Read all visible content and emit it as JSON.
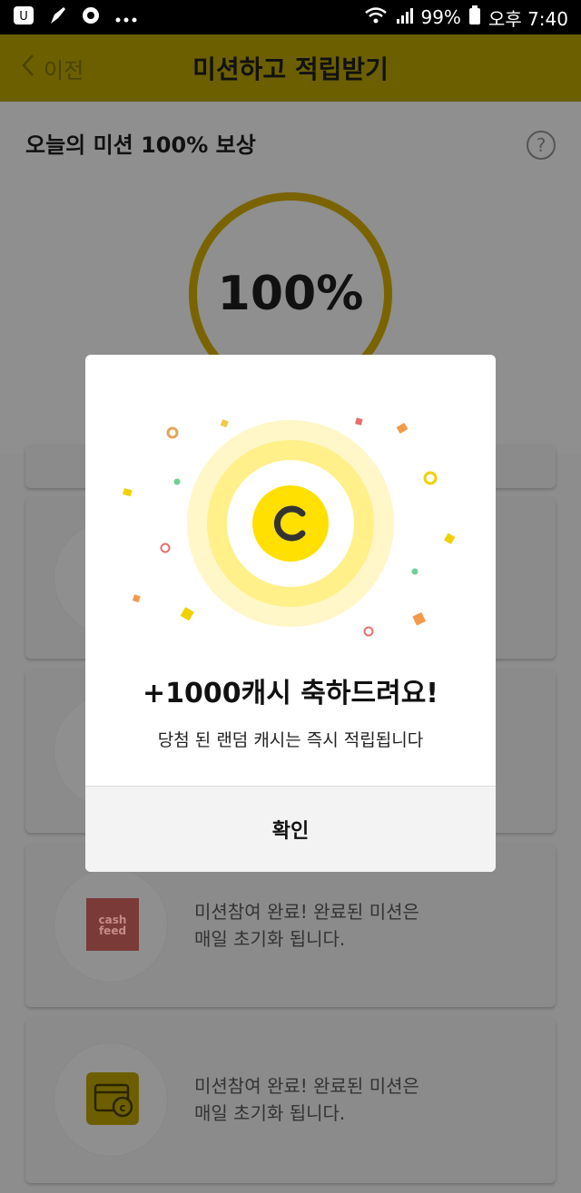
{
  "status_bar": {
    "battery": "99%",
    "time": "오후 7:40",
    "icons": [
      "app-icon",
      "pen-icon",
      "gear-icon",
      "more-dots-icon",
      "wifi-icon",
      "signal-icon",
      "battery-icon"
    ]
  },
  "header": {
    "back_label": "이전",
    "title": "미션하고 적립받기"
  },
  "reward": {
    "title": "오늘의 미션 100% 보상",
    "percent": "100%",
    "progress": 1.0
  },
  "cards": [
    {
      "message_line1": "미션참여 완료!  완료된 미션은",
      "message_line2": "매일 초기화 됩니다.",
      "logo_text": "cash\nfeed"
    },
    {
      "message_line1": "미션참여 완료!  완료된 미션은",
      "message_line2": "매일 초기화 됩니다."
    }
  ],
  "modal": {
    "coin_letter": "C",
    "headline": "+1000캐시 축하드려요!",
    "subtext": "당첨 된 랜덤 캐시는 즉시 적립됩니다",
    "confirm_label": "확인",
    "colors": {
      "coin": "#ffe000",
      "glow_outer": "#fff7c8",
      "glow_mid": "#fff08a"
    }
  }
}
